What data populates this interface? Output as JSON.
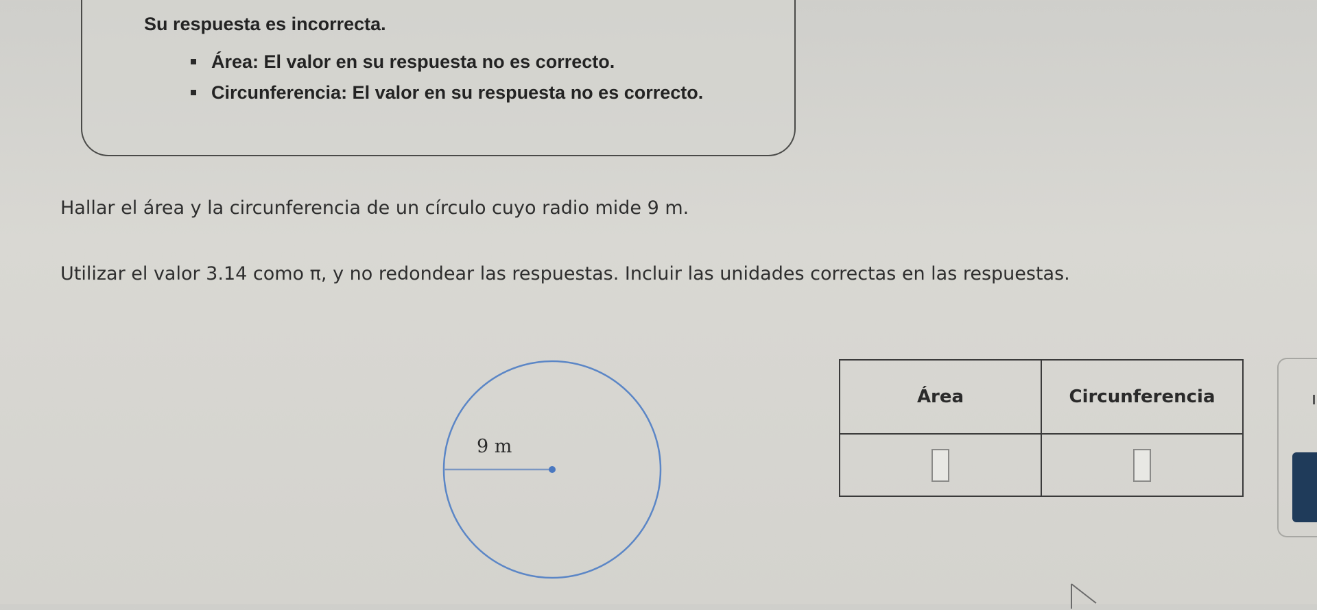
{
  "feedback": {
    "title": "Su respuesta es incorrecta.",
    "items": [
      "Área: El valor en su respuesta no es correcto.",
      "Circunferencia: El valor en su respuesta no es correcto."
    ]
  },
  "problem": {
    "line1": "Hallar el área y la circunferencia de un círculo cuyo radio mide 9 m.",
    "line2": "Utilizar el valor 3.14 como π, y no redondear las respuestas. Incluir las unidades correctas en las respuestas."
  },
  "figure": {
    "radius_label": "9 m",
    "stroke_color": "#5b86c6"
  },
  "answer_table": {
    "headers": [
      "Área",
      "Circunferencia"
    ],
    "area_value": "",
    "circumference_value": ""
  }
}
